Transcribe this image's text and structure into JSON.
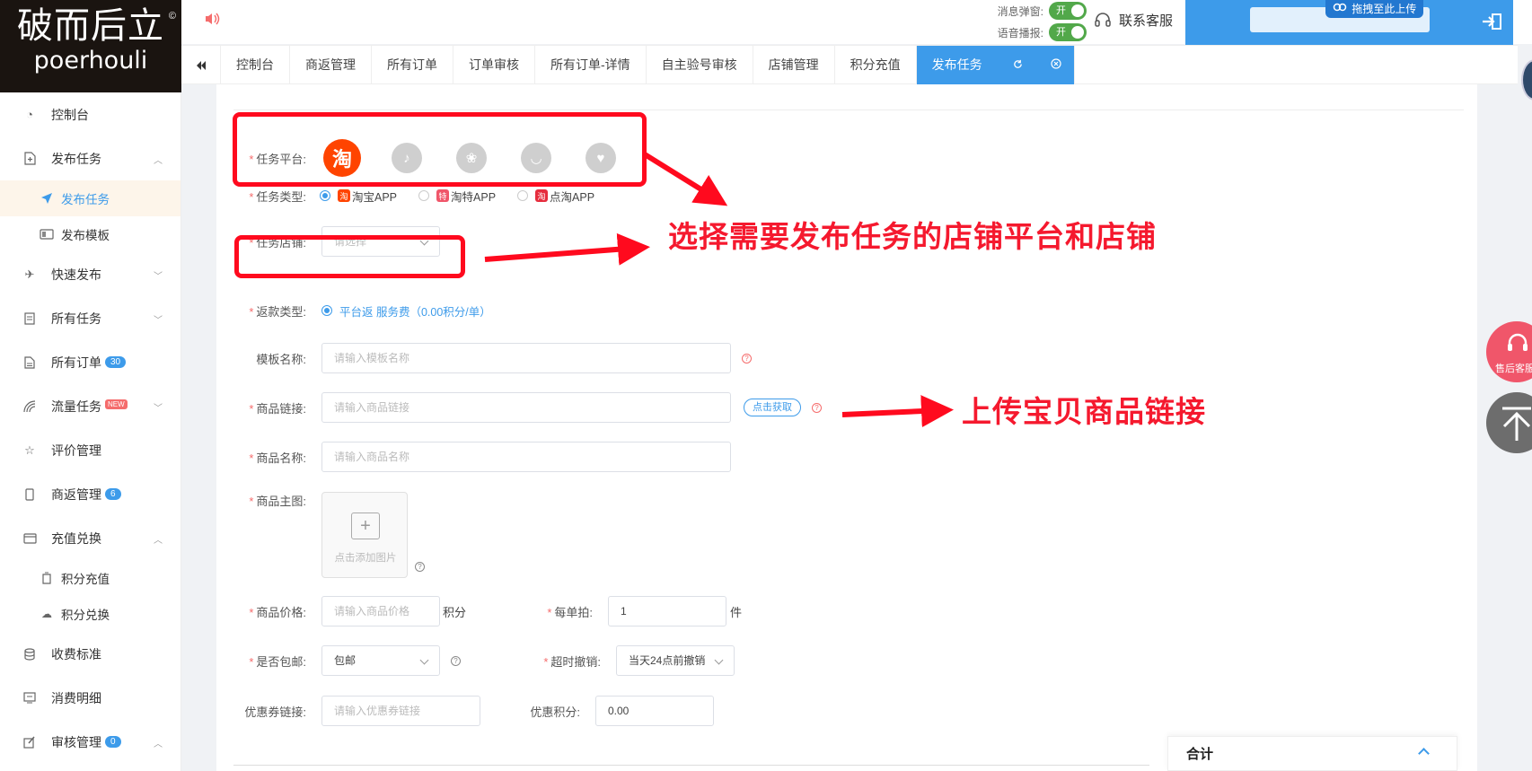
{
  "logo": {
    "cn": "破而后立",
    "en": "poerhouli",
    "mark": "©"
  },
  "header": {
    "popup_label": "消息弹窗:",
    "popup_toggle": "开",
    "voice_label": "语音播报:",
    "voice_toggle": "开",
    "service": "联系客服",
    "upload_tip": "拖拽至此上传"
  },
  "tabs": {
    "items": [
      "控制台",
      "商返管理",
      "所有订单",
      "订单审核",
      "所有订单-详情",
      "自主验号审核",
      "店铺管理",
      "积分充值"
    ],
    "active": "发布任务"
  },
  "sidebar": {
    "console": "控制台",
    "publish": "发布任务",
    "publish_task": "发布任务",
    "publish_template": "发布模板",
    "quick_publish": "快速发布",
    "all_tasks": "所有任务",
    "all_orders": "所有订单",
    "all_orders_badge": "30",
    "traffic_tasks": "流量任务",
    "traffic_badge": "NEW",
    "reviews": "评价管理",
    "rebate": "商返管理",
    "rebate_badge": "6",
    "recharge": "充值兑换",
    "points_recharge": "积分充值",
    "points_exchange": "积分兑换",
    "fees": "收费标准",
    "consumption": "消费明细",
    "audit": "审核管理",
    "audit_badge": "0"
  },
  "form": {
    "req": "*",
    "platform_label": "任务平台:",
    "platforms": {
      "taobao": "淘"
    },
    "type_label": "任务类型:",
    "types": [
      "淘宝APP",
      "淘特APP",
      "点淘APP"
    ],
    "type_icons": [
      "淘",
      "特",
      "淘"
    ],
    "shop_label": "任务店铺:",
    "shop_placeholder": "请选择",
    "refund_label": "返款类型:",
    "refund_value": "平台返 服务费（0.00积分/单）",
    "template_label": "模板名称:",
    "template_placeholder": "请输入模板名称",
    "link_label": "商品链接:",
    "link_placeholder": "请输入商品链接",
    "fetch_button": "点击获取",
    "name_label": "商品名称:",
    "name_placeholder": "请输入商品名称",
    "image_label": "商品主图:",
    "image_caption": "点击添加图片",
    "image_plus": "+",
    "price_label": "商品价格:",
    "price_placeholder": "请输入商品价格",
    "price_unit": "积分",
    "per_order_label": "每单拍:",
    "per_order_value": "1",
    "per_order_unit": "件",
    "shipping_label": "是否包邮:",
    "shipping_value": "包邮",
    "timeout_label": "超时撤销:",
    "timeout_value": "当天24点前撤销",
    "coupon_label": "优惠券链接:",
    "coupon_placeholder": "请输入优惠券链接",
    "coupon_points_label": "优惠积分:",
    "coupon_points_value": "0.00",
    "qmark": "?"
  },
  "total": {
    "label": "合计"
  },
  "annotations": {
    "platform_shop": "选择需要发布任务的店铺平台和店铺",
    "upload_link": "上传宝贝商品链接"
  },
  "float": {
    "service": "售后客服"
  },
  "colors": {
    "primary": "#3d9bea",
    "danger": "#ff0a1e",
    "taobao": "#ff4400",
    "toggle": "#52a84a"
  }
}
